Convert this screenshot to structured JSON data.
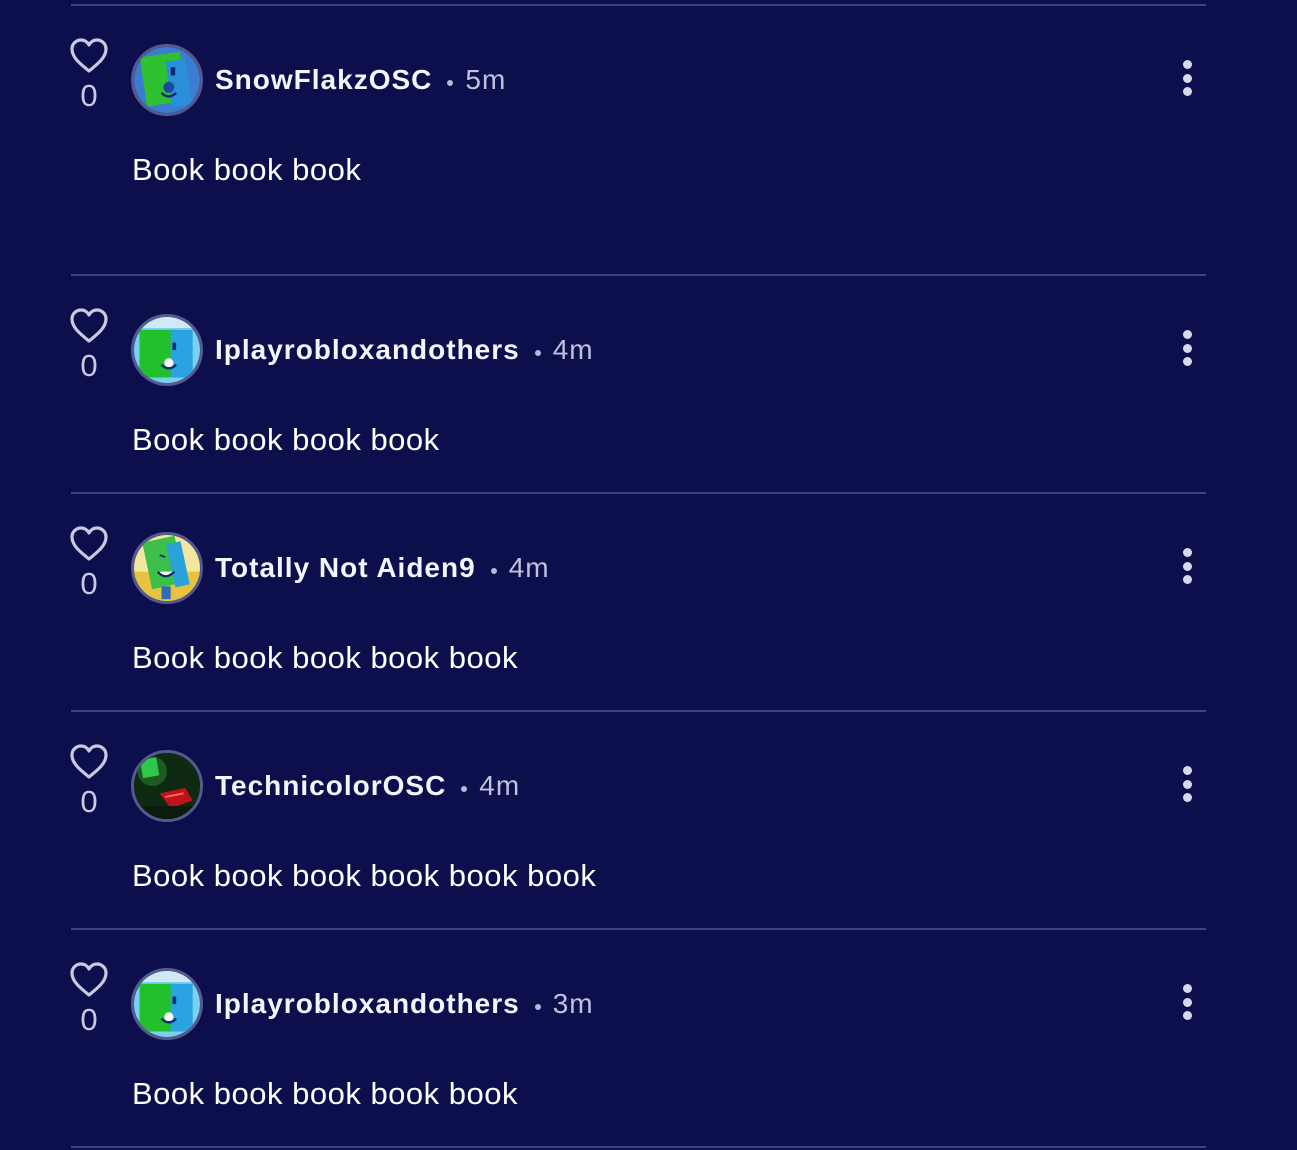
{
  "comments": [
    {
      "likes": "0",
      "username": "SnowFlakzOSC",
      "time": "5m",
      "text": "Book book book",
      "avatar": "green-book-character-avatar"
    },
    {
      "likes": "0",
      "username": "Iplayrobloxandothers",
      "time": "4m",
      "text": "Book book book book",
      "avatar": "green-book-character-avatar"
    },
    {
      "likes": "0",
      "username": "Totally Not Aiden9",
      "time": "4m",
      "text": "Book book book book book",
      "avatar": "green-book-character-avatar"
    },
    {
      "likes": "0",
      "username": "TechnicolorOSC",
      "time": "4m",
      "text": "Book book book book book book",
      "avatar": "dark-red-character-avatar"
    },
    {
      "likes": "0",
      "username": "Iplayrobloxandothers",
      "time": "3m",
      "text": "Book book book book book",
      "avatar": "green-book-character-avatar"
    }
  ],
  "colors": {
    "background": "#0c0f4b",
    "divider": "#3c4480",
    "username": "#f4f5ff",
    "muted": "#bfc2dc"
  },
  "icons": {
    "like": "heart-outline-icon",
    "more": "vertical-ellipsis-icon"
  }
}
